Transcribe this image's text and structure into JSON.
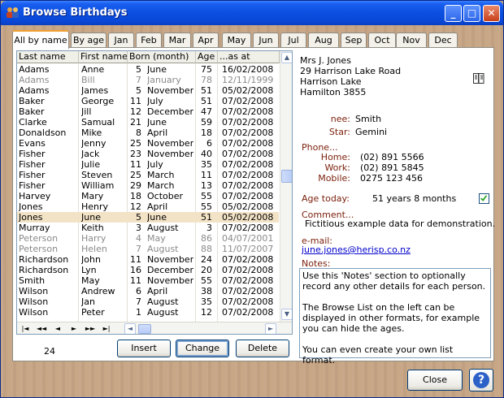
{
  "window": {
    "title": "Browse Birthdays",
    "min_label": "_",
    "max_label": "□",
    "close_label": "✕"
  },
  "tabs": [
    "All by name",
    "By age",
    "Jan",
    "Feb",
    "Mar",
    "Apr",
    "May",
    "Jun",
    "Jul",
    "Aug",
    "Sep",
    "Oct",
    "Nov",
    "Dec"
  ],
  "active_tab": "All by name",
  "grid": {
    "columns": [
      "Last name",
      "First name",
      "Born (month)",
      "Age",
      "...as at"
    ],
    "rows": [
      {
        "last": "Adams",
        "first": "Anne",
        "day": "5",
        "month": "June",
        "age": "75",
        "asat": "16/02/2008",
        "dim": false,
        "sel": false
      },
      {
        "last": "Adams",
        "first": "Bill",
        "day": "7",
        "month": "January",
        "age": "78",
        "asat": "12/11/1999",
        "dim": true,
        "sel": false
      },
      {
        "last": "Adams",
        "first": "James",
        "day": "5",
        "month": "November",
        "age": "51",
        "asat": "05/02/2008",
        "dim": false,
        "sel": false
      },
      {
        "last": "Baker",
        "first": "George",
        "day": "11",
        "month": "July",
        "age": "51",
        "asat": "07/02/2008",
        "dim": false,
        "sel": false
      },
      {
        "last": "Baker",
        "first": "Jill",
        "day": "12",
        "month": "December",
        "age": "47",
        "asat": "07/02/2008",
        "dim": false,
        "sel": false
      },
      {
        "last": "Clarke",
        "first": "Samual",
        "day": "21",
        "month": "June",
        "age": "59",
        "asat": "07/02/2008",
        "dim": false,
        "sel": false
      },
      {
        "last": "Donaldson",
        "first": "Mike",
        "day": "8",
        "month": "April",
        "age": "18",
        "asat": "07/02/2008",
        "dim": false,
        "sel": false
      },
      {
        "last": "Evans",
        "first": "Jenny",
        "day": "25",
        "month": "November",
        "age": "6",
        "asat": "07/02/2008",
        "dim": false,
        "sel": false
      },
      {
        "last": "Fisher",
        "first": "Jack",
        "day": "23",
        "month": "November",
        "age": "40",
        "asat": "07/02/2008",
        "dim": false,
        "sel": false
      },
      {
        "last": "Fisher",
        "first": "Julie",
        "day": "11",
        "month": "July",
        "age": "35",
        "asat": "07/02/2008",
        "dim": false,
        "sel": false
      },
      {
        "last": "Fisher",
        "first": "Steven",
        "day": "25",
        "month": "March",
        "age": "11",
        "asat": "07/02/2008",
        "dim": false,
        "sel": false
      },
      {
        "last": "Fisher",
        "first": "William",
        "day": "29",
        "month": "March",
        "age": "13",
        "asat": "07/02/2008",
        "dim": false,
        "sel": false
      },
      {
        "last": "Harvey",
        "first": "Mary",
        "day": "18",
        "month": "October",
        "age": "55",
        "asat": "07/02/2008",
        "dim": false,
        "sel": false
      },
      {
        "last": "Jones",
        "first": "Henry",
        "day": "12",
        "month": "April",
        "age": "55",
        "asat": "05/02/2008",
        "dim": false,
        "sel": false
      },
      {
        "last": "Jones",
        "first": "June",
        "day": "5",
        "month": "June",
        "age": "51",
        "asat": "05/02/2008",
        "dim": false,
        "sel": true
      },
      {
        "last": "Murray",
        "first": "Keith",
        "day": "3",
        "month": "August",
        "age": "3",
        "asat": "07/02/2008",
        "dim": false,
        "sel": false
      },
      {
        "last": "Peterson",
        "first": "Harry",
        "day": "4",
        "month": "May",
        "age": "86",
        "asat": "04/07/2001",
        "dim": true,
        "sel": false
      },
      {
        "last": "Peterson",
        "first": "Helen",
        "day": "7",
        "month": "August",
        "age": "88",
        "asat": "11/07/2007",
        "dim": true,
        "sel": false
      },
      {
        "last": "Richardson",
        "first": "John",
        "day": "11",
        "month": "November",
        "age": "24",
        "asat": "07/02/2008",
        "dim": false,
        "sel": false
      },
      {
        "last": "Richardson",
        "first": "Lyn",
        "day": "16",
        "month": "December",
        "age": "20",
        "asat": "07/02/2008",
        "dim": false,
        "sel": false
      },
      {
        "last": "Smith",
        "first": "May",
        "day": "11",
        "month": "November",
        "age": "55",
        "asat": "07/02/2008",
        "dim": false,
        "sel": false
      },
      {
        "last": "Wilson",
        "first": "Andrew",
        "day": "6",
        "month": "April",
        "age": "38",
        "asat": "07/02/2008",
        "dim": false,
        "sel": false
      },
      {
        "last": "Wilson",
        "first": "Jan",
        "day": "7",
        "month": "August",
        "age": "35",
        "asat": "07/02/2008",
        "dim": false,
        "sel": false
      },
      {
        "last": "Wilson",
        "first": "Peter",
        "day": "1",
        "month": "August",
        "age": "12",
        "asat": "07/02/2008",
        "dim": false,
        "sel": false
      }
    ],
    "nav_buttons": [
      "|◄",
      "◄◄",
      "◄",
      "►",
      "►►",
      "►|"
    ],
    "record_count": "24"
  },
  "buttons": {
    "insert": "Insert",
    "change": "Change",
    "delete": "Delete",
    "close": "Close",
    "help": "?"
  },
  "detail": {
    "address": [
      "Mrs J. Jones",
      "29 Harrison Lake Road",
      "Harrison Lake",
      "Hamilton 3855"
    ],
    "nee_label": "nee:",
    "nee": "Smith",
    "star_label": "Star:",
    "star": "Gemini",
    "phone_label": "Phone...",
    "home_label": "Home:",
    "home": "(02) 891 5566",
    "work_label": "Work:",
    "work": "(02) 891 5845",
    "mobile_label": "Mobile:",
    "mobile": "0275 123 456",
    "age_today_label": "Age today:",
    "age_today": "51 years 8 months",
    "age_checked": true,
    "comment_label": "Comment...",
    "comment": "Fictitious example data for demonstration.",
    "email_label": "e-mail:",
    "email": "june.jones@herisp.co.nz",
    "notes_label": "Notes:",
    "notes": [
      "Use this 'Notes' section to optionally record any other details for each person.",
      "The Browse List on the left can be displayed in other formats, for example you can hide the ages.",
      "You can even create your own list format."
    ]
  },
  "colors": {
    "title_bar": "#0a47d6",
    "selected_row": "#f3e3c6",
    "label_red": "#7a1e0a",
    "email_blue": "#0000cc",
    "window_bg": "#c6a584"
  }
}
